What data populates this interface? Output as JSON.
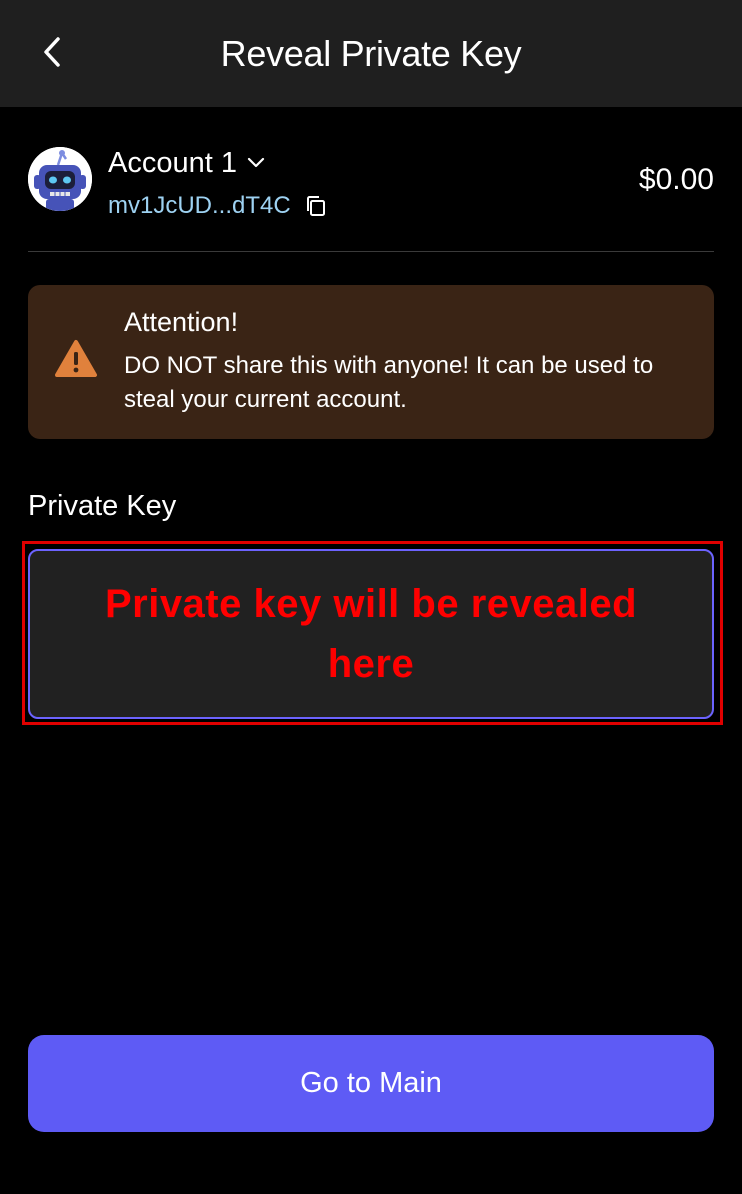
{
  "header": {
    "title": "Reveal Private Key",
    "back_icon": "chevron-left-icon"
  },
  "account": {
    "name": "Account 1",
    "dropdown_icon": "chevron-down-icon",
    "address": "mv1JcUD...dT4C",
    "copy_icon": "copy-icon",
    "balance": "$0.00",
    "avatar_icon": "robot-avatar"
  },
  "warning": {
    "icon": "warning-triangle-icon",
    "title": "Attention!",
    "text": "DO NOT share this with anyone! It can be used to steal your current account."
  },
  "private_key": {
    "label": "Private Key",
    "placeholder": "Private key will be revealed here"
  },
  "actions": {
    "main_button": "Go to Main"
  },
  "colors": {
    "background": "#000000",
    "header": "#1f1f1f",
    "accent": "#5e5bf5",
    "address": "#9ed2f2",
    "warning_bg": "#3a2415",
    "warning_icon": "#e0813c",
    "annotation_red": "#ff0000"
  }
}
